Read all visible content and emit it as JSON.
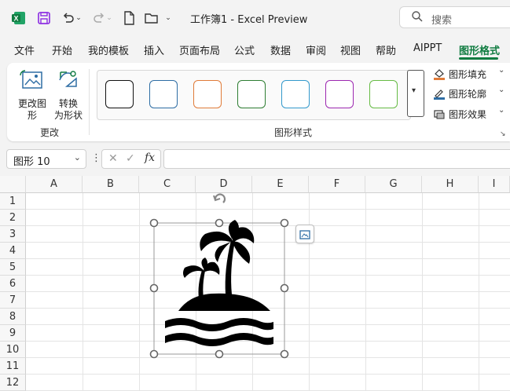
{
  "window": {
    "title": "工作簿1 - Excel Preview"
  },
  "search": {
    "placeholder": "搜索"
  },
  "tabs": [
    "文件",
    "开始",
    "我的模板",
    "插入",
    "页面布局",
    "公式",
    "数据",
    "审阅",
    "视图",
    "帮助",
    "AIPPT",
    "图形格式"
  ],
  "active_tab": "图形格式",
  "ribbon": {
    "change_graphic": "更改图\n形",
    "convert_to_shape": "转换\n为形状",
    "change_group": "更改",
    "styles_group": "图形样式",
    "fill": "图形填充",
    "outline": "图形轮廓",
    "effects": "图形效果",
    "style_swatches": [
      "#111111",
      "#2e6da4",
      "#e07b39",
      "#2e7d32",
      "#3399cc",
      "#9c27b0",
      "#66bb44"
    ]
  },
  "name_box": {
    "value": "图形 10"
  },
  "formula_bar": {
    "fx": "fx",
    "value": ""
  },
  "columns": [
    "A",
    "B",
    "C",
    "D",
    "E",
    "F",
    "G",
    "H",
    "I"
  ],
  "rows": [
    "1",
    "2",
    "3",
    "4",
    "5",
    "6",
    "7",
    "8",
    "9",
    "10",
    "11",
    "12"
  ],
  "selected_shape": {
    "name": "palm-island-icon"
  },
  "colors": {
    "accent": "#107c41"
  }
}
